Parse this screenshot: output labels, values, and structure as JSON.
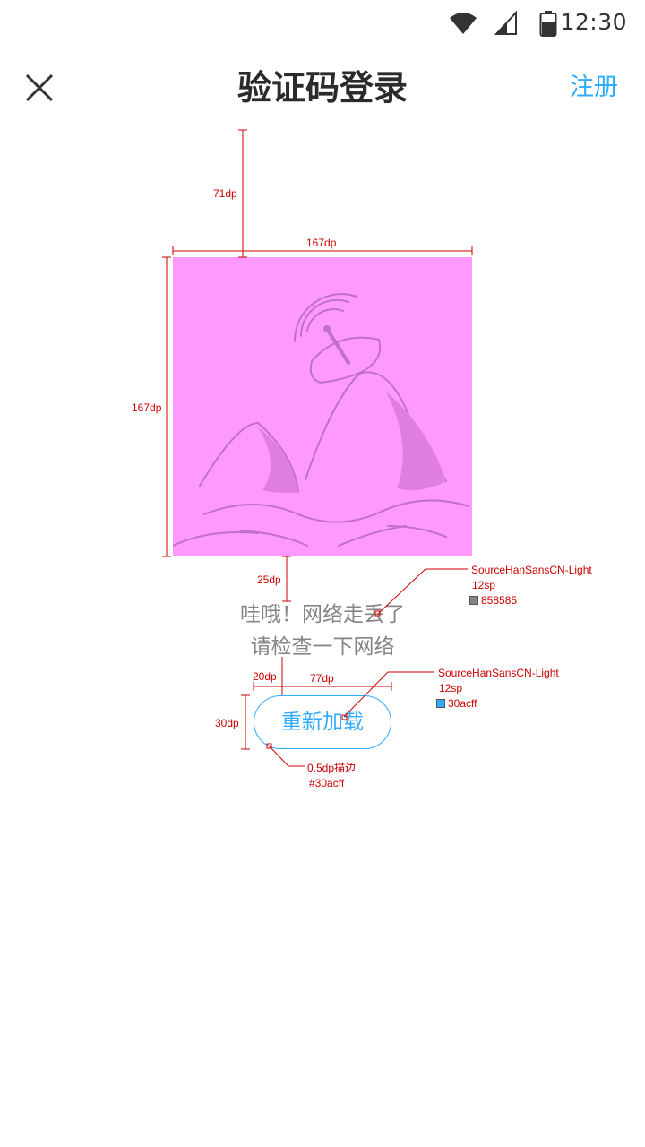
{
  "status_bar": {
    "time": "12:30",
    "icons": [
      "wifi-icon",
      "signal-icon",
      "battery-icon"
    ]
  },
  "header": {
    "title": "验证码登录",
    "close_icon": "close-icon",
    "register_label": "注册"
  },
  "illustration": {
    "icon": "network-error-illustration",
    "background": "#ff99ff",
    "stroke": "#c070c8"
  },
  "message": {
    "line1": "哇哦！网络走丢了",
    "line2": "请检查一下网络"
  },
  "reload_button": {
    "label": "重新加载"
  },
  "colors": {
    "accent": "#30acff",
    "message_text": "#858585",
    "annotation": "#cc0000"
  },
  "annotations": {
    "gap_top": "71dp",
    "image_width": "167dp",
    "image_height": "167dp",
    "gap_text": "25dp",
    "text_font": "SourceHanSansCN-Light",
    "text_size": "12sp",
    "text_color": "858585",
    "button_font": "SourceHanSansCN-Light",
    "button_size": "12sp",
    "button_color": "30acff",
    "button_padding": "20dp",
    "button_width": "77dp",
    "button_height": "30dp",
    "stroke_note": "0.5dp描边",
    "stroke_color": "#30acff"
  }
}
